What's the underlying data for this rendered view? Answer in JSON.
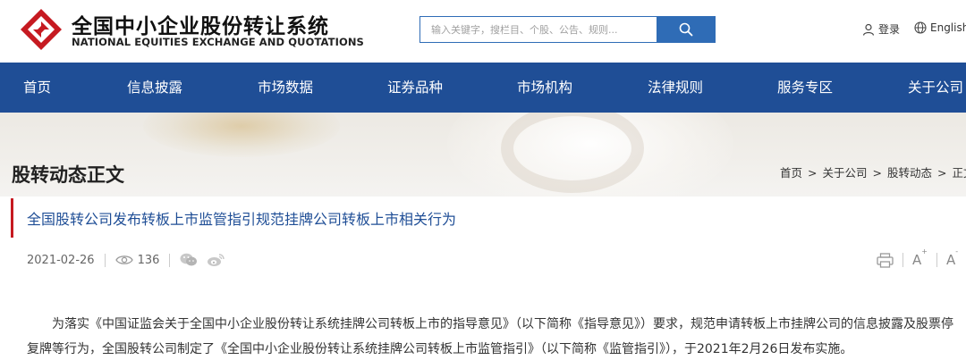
{
  "header": {
    "logo_cn": "全国中小企业股份转让系统",
    "logo_en": "NATIONAL EQUITIES EXCHANGE AND QUOTATIONS",
    "search_placeholder": "输入关键字，搜栏目、个股、公告、规则...",
    "login_label": "登录",
    "english_label": "English"
  },
  "nav": {
    "items": [
      "首页",
      "信息披露",
      "市场数据",
      "证券品种",
      "市场机构",
      "法律规则",
      "服务专区",
      "关于公司"
    ]
  },
  "banner": {
    "title": "股转动态正文",
    "breadcrumb": [
      "首页",
      "关于公司",
      "股转动态",
      "正文"
    ]
  },
  "article": {
    "title": "全国股转公司发布转板上市监管指引规范挂牌公司转板上市相关行为",
    "date": "2021-02-26",
    "views": "136",
    "font_up": "A",
    "font_down": "A",
    "para_line1": "为落实《中国证监会关于全国中小企业股份转让系统挂牌公司转板上市的指导意见》（以下简称《指导意见》）要求，规范申请转板上市挂牌公司的信息披露及股票停",
    "para_line2": "复牌等行为，全国股转公司制定了《全国中小企业股份转让系统挂牌公司转板上市监管指引》（以下简称《监管指引》），于2021年2月26日发布实施。"
  },
  "colors": {
    "brand_red": "#c61a21",
    "nav_blue": "#1f4e96",
    "search_blue": "#2f6cb6",
    "title_blue": "#1f4e96"
  },
  "icons": [
    "logo-icon",
    "search-icon",
    "user-icon",
    "globe-icon",
    "eye-icon",
    "wechat-icon",
    "weibo-icon",
    "print-icon"
  ]
}
